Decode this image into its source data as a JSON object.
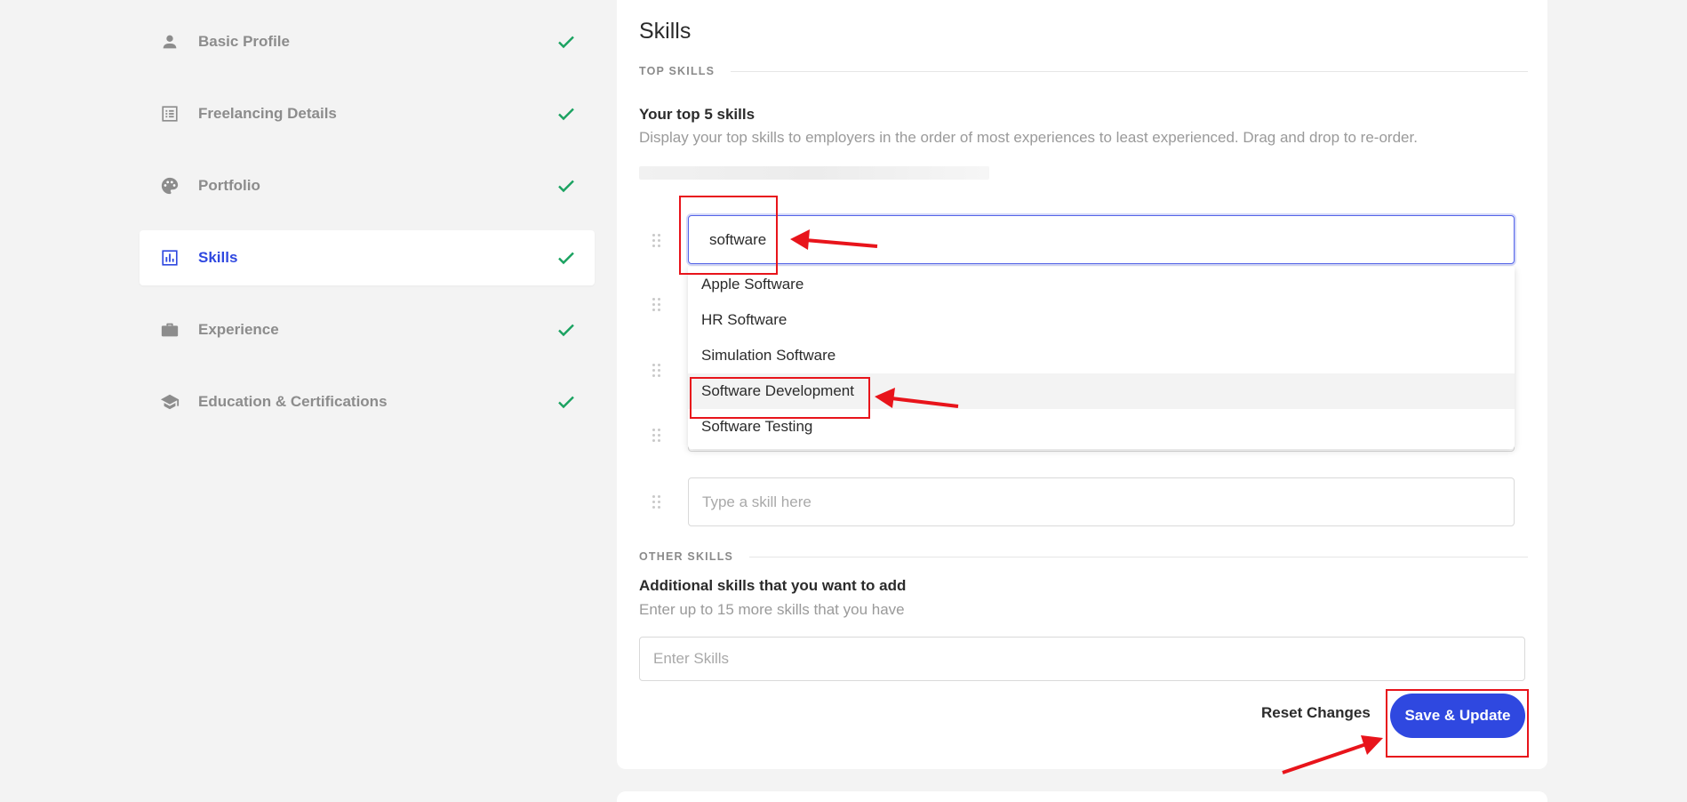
{
  "sidebar": {
    "items": [
      {
        "label": "Basic Profile",
        "icon": "person-icon",
        "completed": true,
        "active": false
      },
      {
        "label": "Freelancing Details",
        "icon": "list-icon",
        "completed": true,
        "active": false
      },
      {
        "label": "Portfolio",
        "icon": "palette-icon",
        "completed": true,
        "active": false
      },
      {
        "label": "Skills",
        "icon": "bar-chart-icon",
        "completed": true,
        "active": true
      },
      {
        "label": "Experience",
        "icon": "briefcase-icon",
        "completed": true,
        "active": false
      },
      {
        "label": "Education & Certifications",
        "icon": "graduation-cap-icon",
        "completed": true,
        "active": false
      }
    ]
  },
  "main": {
    "title": "Skills",
    "top_skills": {
      "section_label": "TOP SKILLS",
      "heading": "Your top 5 skills",
      "description": "Display your top skills to employers in the order of most experiences to least experienced. Drag and drop to re-order.",
      "active_input_value": "software",
      "empty_placeholder": "Type a skill here",
      "suggestions": [
        "Apple Software",
        "HR Software",
        "Simulation Software",
        "Software Development",
        "Software Testing"
      ],
      "highlighted_suggestion": "Software Development"
    },
    "other_skills": {
      "section_label": "OTHER SKILLS",
      "heading": "Additional skills that you want to add",
      "description": "Enter up to 15 more skills that you have",
      "placeholder": "Enter Skills"
    },
    "actions": {
      "reset_label": "Reset Changes",
      "save_label": "Save & Update"
    }
  },
  "colors": {
    "accent": "#2f48e0",
    "check": "#1aa260",
    "annotation": "#e8141b"
  }
}
